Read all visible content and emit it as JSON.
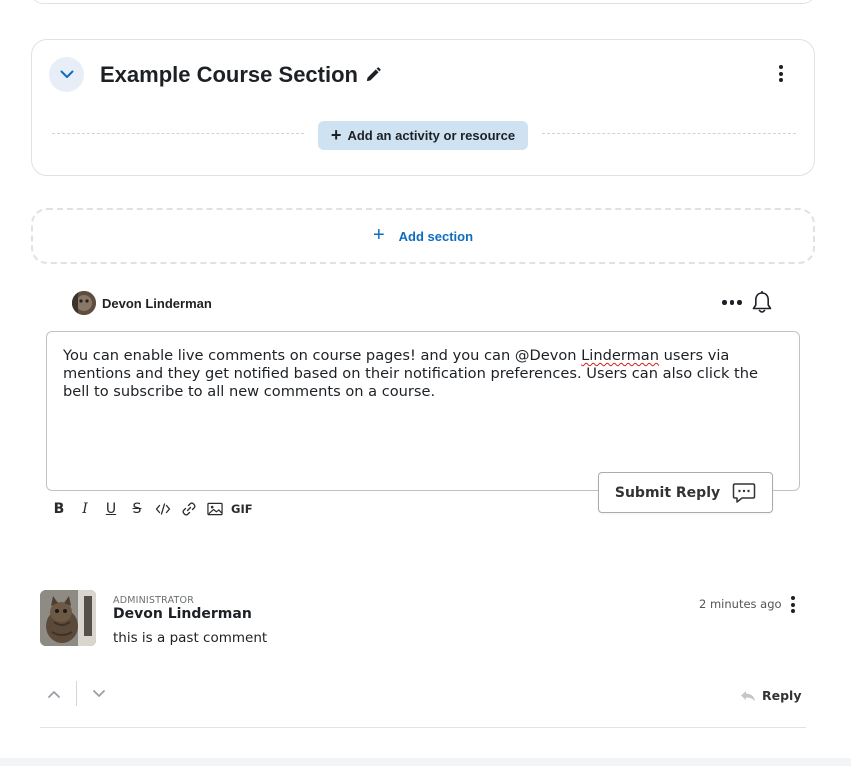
{
  "section": {
    "title": "Example Course Section",
    "add_activity_label": "Add an activity or resource"
  },
  "add_section": {
    "label": "Add section"
  },
  "composer": {
    "user_name": "Devon Linderman",
    "text_before": "You can enable live comments on course pages! and you can @Devon ",
    "text_misspelled": "Linderman",
    "text_after": " users via mentions and they get notified based on their notification preferences. Users can also click the bell to subscribe to all new comments on a course.",
    "submit_label": "Submit Reply",
    "toolbar": [
      {
        "name": "bold-icon",
        "glyph": "B"
      },
      {
        "name": "italic-icon",
        "glyph": "I"
      },
      {
        "name": "underline-icon",
        "glyph": "U"
      },
      {
        "name": "strikethrough-icon",
        "glyph": "S"
      },
      {
        "name": "code-icon"
      },
      {
        "name": "link-icon"
      },
      {
        "name": "image-icon"
      },
      {
        "name": "gif-button",
        "label": "GIF"
      }
    ]
  },
  "comment": {
    "role": "ADMINISTRATOR",
    "author": "Devon Linderman",
    "text": "this is a past comment",
    "time": "2 minutes ago",
    "reply_label": "Reply"
  },
  "colors": {
    "accent": "#0f6cbf",
    "add_activity_bg": "#cfe2f2",
    "collapse_bg": "#e7eef7",
    "border": "#dee2e6",
    "spellcheck": "#d02020"
  }
}
